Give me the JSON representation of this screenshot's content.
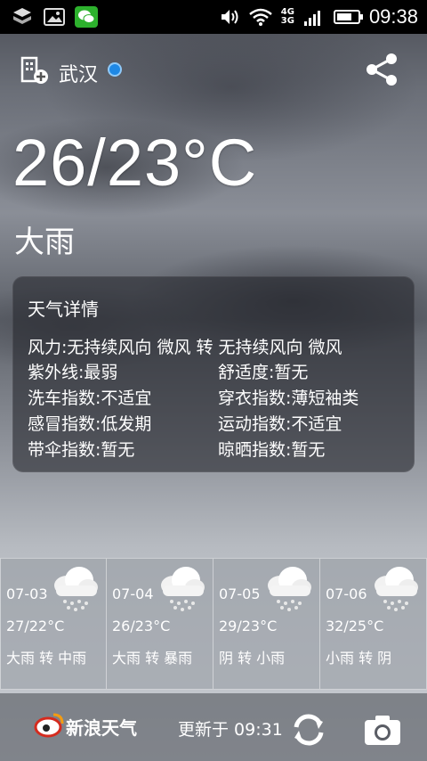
{
  "statusbar": {
    "network_top": "4G",
    "network_bottom": "3G",
    "time": "09:38"
  },
  "header": {
    "city": "武汉"
  },
  "current": {
    "temperature": "26/23°C",
    "condition": "大雨"
  },
  "details": {
    "title": "天气详情",
    "wind": "风力:无持续风向 微风 转 无持续风向 微风",
    "items": [
      [
        "紫外线:最弱",
        "舒适度:暂无"
      ],
      [
        "洗车指数:不适宜",
        "穿衣指数:薄短袖类"
      ],
      [
        "感冒指数:低发期",
        "运动指数:不适宜"
      ],
      [
        "带伞指数:暂无",
        "晾晒指数:暂无"
      ]
    ]
  },
  "forecast": [
    {
      "date": "07-03",
      "range": "27/22°C",
      "desc": "大雨 转 中雨",
      "icon": "rain-cloud-icon"
    },
    {
      "date": "07-04",
      "range": "26/23°C",
      "desc": "大雨 转 暴雨",
      "icon": "rain-cloud-icon"
    },
    {
      "date": "07-05",
      "range": "29/23°C",
      "desc": "阴 转 小雨",
      "icon": "rain-cloud-icon"
    },
    {
      "date": "07-06",
      "range": "32/25°C",
      "desc": "小雨 转 阴",
      "icon": "rain-cloud-icon"
    }
  ],
  "footer": {
    "brand": "新浪天气",
    "updated": "更新于 09:31"
  }
}
